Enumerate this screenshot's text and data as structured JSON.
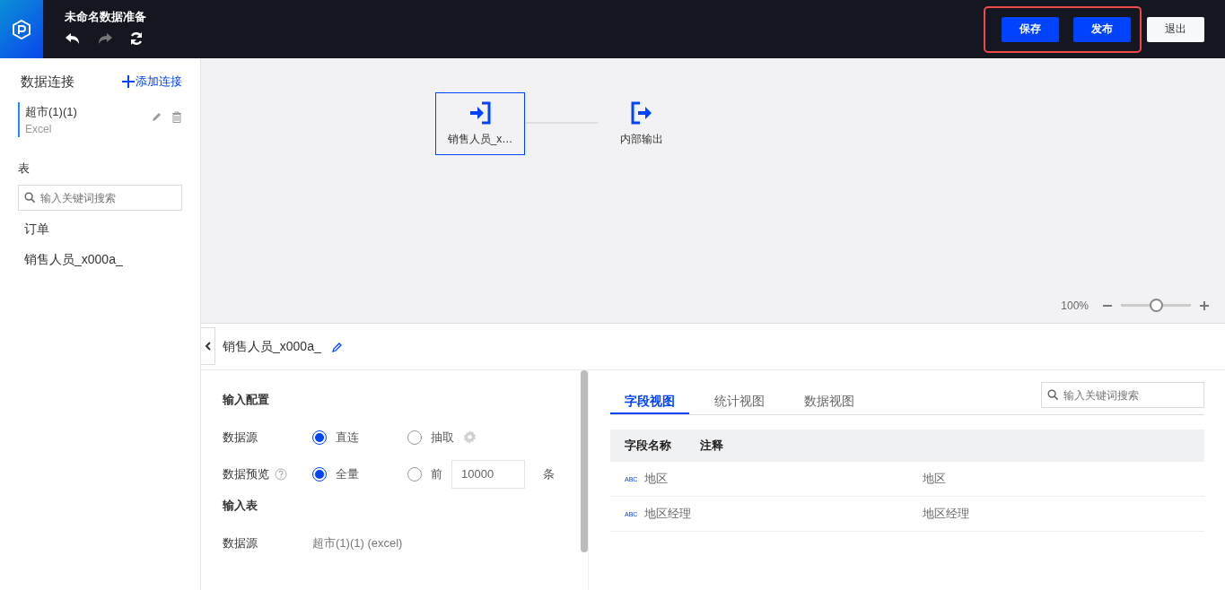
{
  "header": {
    "title": "未命名数据准备",
    "tools": [
      {
        "kind": "undo",
        "disabled": false
      },
      {
        "kind": "redo",
        "disabled": true
      },
      {
        "kind": "refresh",
        "disabled": false
      }
    ],
    "actions": [
      {
        "label": "保存",
        "kind": "primary"
      },
      {
        "label": "发布",
        "kind": "primary"
      },
      {
        "label": "退出",
        "kind": "secondary"
      }
    ]
  },
  "sidebar": {
    "title": "数据连接",
    "add_link": "添加连接",
    "connections": [
      {
        "name": "超市(1)(1)",
        "type": "Excel",
        "selected": true
      }
    ],
    "tables_title": "表",
    "search": {
      "placeholder": "输入关键词搜索"
    },
    "tables": [
      "订单",
      "销售人员_x000a_"
    ]
  },
  "canvas": {
    "nodes": [
      {
        "kind": "input",
        "label": "销售人员_x…",
        "selected": true
      },
      {
        "kind": "output",
        "label": "内部输出",
        "selected": false
      }
    ],
    "zoom": {
      "reading": "100%",
      "level": 0.5
    }
  },
  "panel": {
    "title": "销售人员_x000a_",
    "sections": [
      {
        "title": "输入配置",
        "rows": [
          {
            "kind": "radio",
            "label": "数据源",
            "help": false,
            "options": [
              {
                "label": "直连",
                "selected": true
              },
              {
                "label": "抽取",
                "selected": false,
                "kind": "settings"
              }
            ]
          },
          {
            "kind": "radio",
            "label": "数据预览",
            "help": true,
            "options": [
              {
                "label": "全量",
                "selected": true
              },
              {
                "label": "前",
                "selected": false,
                "kind": "count",
                "value": "10000",
                "unit": "条"
              }
            ]
          }
        ]
      },
      {
        "title": "输入表",
        "rows": [
          {
            "kind": "text",
            "label": "数据源",
            "value": "超市(1)(1) (excel)"
          }
        ]
      }
    ],
    "tabs": [
      {
        "label": "字段视图",
        "selected": true
      },
      {
        "label": "统计视图",
        "selected": false
      },
      {
        "label": "数据视图",
        "selected": false
      }
    ],
    "search": {
      "placeholder": "输入关键词搜索"
    },
    "columns": [
      "字段名称",
      "注释"
    ],
    "rows": [
      {
        "type": "ABC",
        "name": "地区",
        "comment": "地区"
      },
      {
        "type": "ABC",
        "name": "地区经理",
        "comment": "地区经理"
      }
    ]
  }
}
